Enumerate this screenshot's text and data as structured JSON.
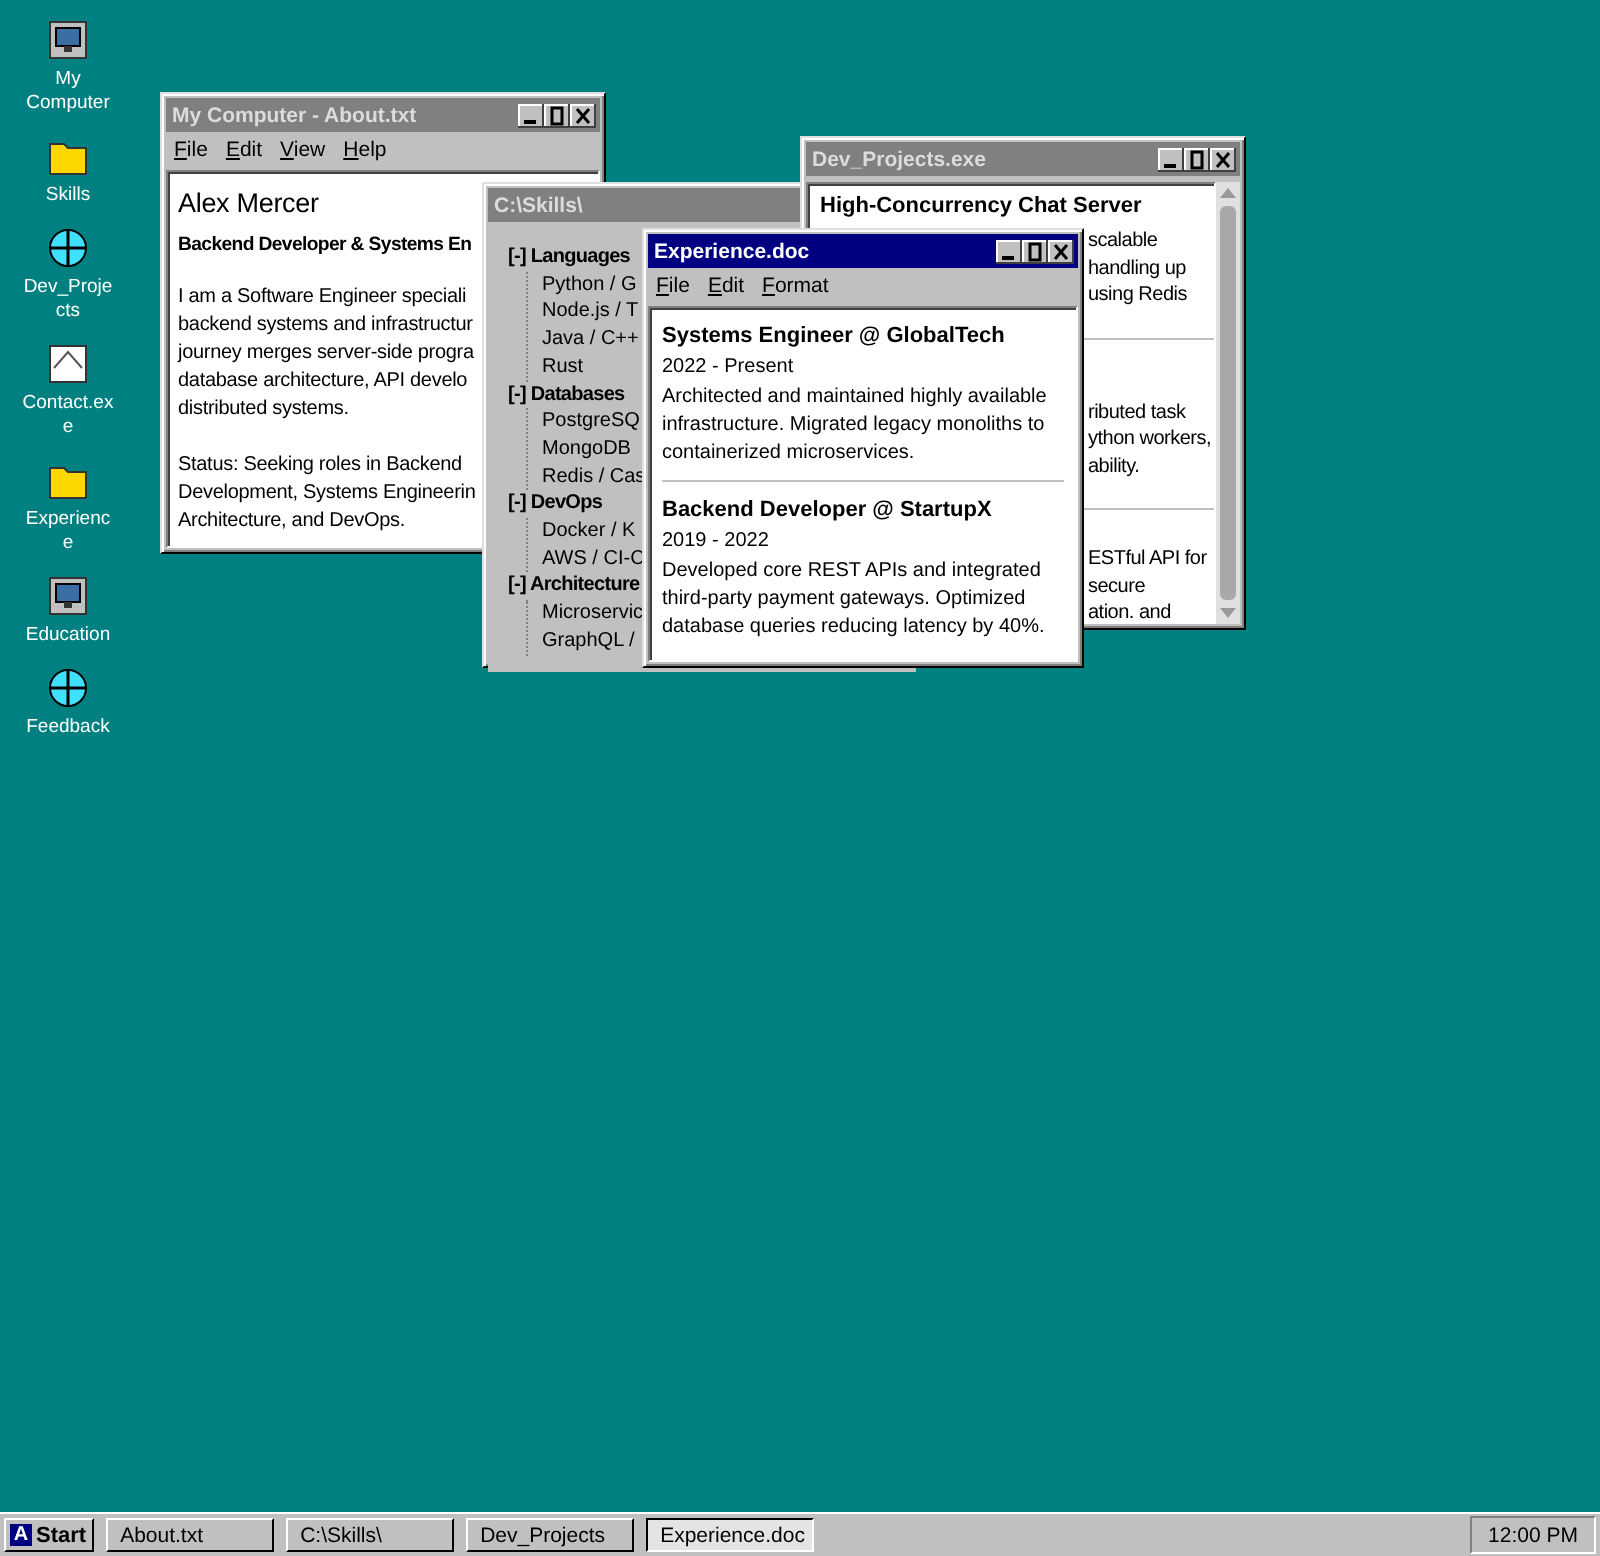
{
  "desktop_icons": [
    {
      "label": "My Computer",
      "kind": "computer"
    },
    {
      "label": "Skills",
      "kind": "folder"
    },
    {
      "label": "Dev_Projects",
      "kind": "globe"
    },
    {
      "label": "Contact.exe",
      "kind": "document"
    },
    {
      "label": "Experience",
      "kind": "folder"
    },
    {
      "label": "Education",
      "kind": "computer"
    },
    {
      "label": "Feedback",
      "kind": "globe"
    }
  ],
  "windows": [
    {
      "kind": "about",
      "title": "My Computer - About.txt",
      "active": false,
      "menu": [
        "File",
        "Edit",
        "View",
        "Help"
      ],
      "heading": "Alex Mercer",
      "subheading": "Backend Developer & Systems En",
      "paragraphs": [
        [
          "I am a Software Engineer speciali",
          "backend systems and infrastructur",
          "journey merges server-side progra",
          "database architecture, API develo",
          "distributed systems."
        ],
        [
          "Status: Seeking roles in Backend",
          "Development, Systems Engineerin",
          "Architecture, and DevOps."
        ]
      ]
    },
    {
      "kind": "tree",
      "title": "C:\\Skills\\",
      "active": false,
      "tree": [
        {
          "label": "[-] Languages",
          "children": [
            {
              "label": "Python / G"
            },
            {
              "label": "Node.js / T"
            },
            {
              "label": "Java / C++"
            },
            {
              "label": "Rust"
            }
          ]
        },
        {
          "label": "[-] Databases",
          "children": [
            {
              "label": "PostgreSQ"
            },
            {
              "label": "MongoDB"
            },
            {
              "label": "Redis / Cas"
            }
          ]
        },
        {
          "label": "[-] DevOps",
          "children": [
            {
              "label": "Docker / K"
            },
            {
              "label": "AWS / CI-C"
            }
          ]
        },
        {
          "label": "[-] Architecture",
          "children": [
            {
              "label": "Microservic"
            },
            {
              "label": "GraphQL /"
            }
          ]
        }
      ]
    },
    {
      "kind": "projects",
      "title": "Dev_Projects.exe",
      "active": false,
      "heading": "High-Concurrency Chat Server",
      "sections": [
        [
          "scalable",
          "handling up",
          "using Redis"
        ],
        [
          "ributed task",
          "ython workers,",
          "ability."
        ],
        [
          "ESTful API for",
          "secure",
          "ation. and"
        ]
      ]
    },
    {
      "kind": "doc",
      "title": "Experience.doc",
      "active": true,
      "menu": [
        "File",
        "Edit",
        "Format"
      ],
      "entries": [
        {
          "role": "Systems Engineer @ GlobalTech",
          "dates": "2022 - Present",
          "description": "Architected and maintained highly available infrastructure. Migrated legacy monoliths to containerized microservices."
        },
        {
          "role": "Backend Developer @ StartupX",
          "dates": "2019 - 2022",
          "description": "Developed core REST APIs and integrated third-party payment gateways. Optimized database queries reducing latency by 40%."
        }
      ]
    }
  ],
  "taskbar": {
    "start": {
      "logo": "A",
      "label": "Start"
    },
    "tasks": [
      {
        "label": "About.txt",
        "selected": false
      },
      {
        "label": "C:\\Skills\\",
        "selected": false
      },
      {
        "label": "Dev_Projects",
        "selected": false
      },
      {
        "label": "Experience.doc",
        "selected": true
      }
    ],
    "clock": "12:00 PM"
  }
}
